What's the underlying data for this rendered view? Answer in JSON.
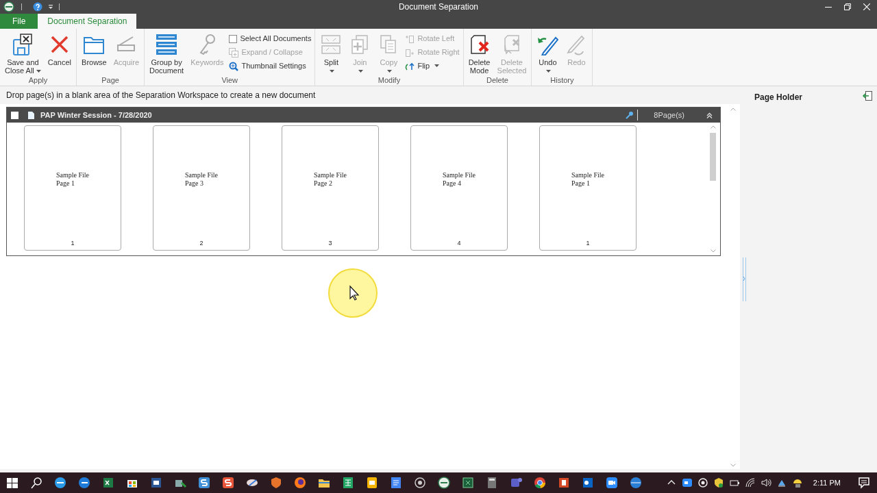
{
  "window": {
    "title": "Document Separation"
  },
  "ribbon_tabs": [
    {
      "label": "File",
      "kind": "file",
      "selected": false
    },
    {
      "label": "Document Separation",
      "kind": "tab",
      "selected": true
    }
  ],
  "ribbon_groups": [
    {
      "label": "Apply",
      "items": [
        {
          "kind": "large",
          "label": "Save and\nClose All",
          "has_menu": true,
          "disabled": false
        },
        {
          "kind": "large",
          "label": "Cancel",
          "has_menu": false,
          "disabled": false
        }
      ]
    },
    {
      "label": "Page",
      "items": [
        {
          "kind": "large",
          "label": "Browse",
          "has_menu": false,
          "disabled": false
        },
        {
          "kind": "large",
          "label": "Acquire",
          "has_menu": false,
          "disabled": true
        }
      ]
    },
    {
      "label": "View",
      "items": [
        {
          "kind": "large",
          "label": "Group by\nDocument",
          "has_menu": false,
          "disabled": false
        },
        {
          "kind": "large",
          "label": "Keywords",
          "has_menu": false,
          "disabled": true
        },
        {
          "kind": "column",
          "items": [
            {
              "kind": "checkbox",
              "label": "Select All Documents",
              "checked": false,
              "disabled": false
            },
            {
              "kind": "small",
              "label": "Expand / Collapse",
              "has_menu": false,
              "disabled": true
            },
            {
              "kind": "small",
              "label": "Thumbnail Settings",
              "has_menu": false,
              "disabled": false
            }
          ]
        }
      ]
    },
    {
      "label": "Modify",
      "items": [
        {
          "kind": "large",
          "label": "Split",
          "has_menu": true,
          "disabled": false
        },
        {
          "kind": "large",
          "label": "Join",
          "has_menu": true,
          "disabled": true
        },
        {
          "kind": "large",
          "label": "Copy",
          "has_menu": true,
          "disabled": true
        },
        {
          "kind": "column",
          "items": [
            {
              "kind": "small",
              "label": "Rotate Left",
              "has_menu": false,
              "disabled": true
            },
            {
              "kind": "small",
              "label": "Rotate Right",
              "has_menu": false,
              "disabled": true
            },
            {
              "kind": "small",
              "label": "Flip",
              "has_menu": true,
              "disabled": false
            }
          ]
        }
      ]
    },
    {
      "label": "Delete",
      "items": [
        {
          "kind": "large",
          "label": "Delete\nMode",
          "has_menu": false,
          "disabled": false
        },
        {
          "kind": "large",
          "label": "Delete\nSelected",
          "has_menu": false,
          "disabled": true
        }
      ]
    },
    {
      "label": "History",
      "items": [
        {
          "kind": "large",
          "label": "Undo",
          "has_menu": true,
          "disabled": false
        },
        {
          "kind": "large",
          "label": "Redo",
          "has_menu": false,
          "disabled": true
        }
      ]
    }
  ],
  "instruction": "Drop page(s) in a blank area of the Separation Workspace to create a new document",
  "document": {
    "title": "PAP Winter Session - 7/28/2020",
    "checked": false,
    "page_count": "8Page(s)",
    "pages": [
      {
        "line_1": "Sample File",
        "line_2": "Page 1",
        "number": "1"
      },
      {
        "line_1": "Sample File",
        "line_2": "Page 3",
        "number": "2"
      },
      {
        "line_1": "Sample File",
        "line_2": "Page 2",
        "number": "3"
      },
      {
        "line_1": "Sample File",
        "line_2": "Page 4",
        "number": "4"
      },
      {
        "line_1": "Sample File",
        "line_2": "Page 1",
        "number": "1"
      }
    ]
  },
  "page_holder": {
    "title": "Page Holder"
  },
  "taskbar": {
    "time": "2:11 PM"
  }
}
